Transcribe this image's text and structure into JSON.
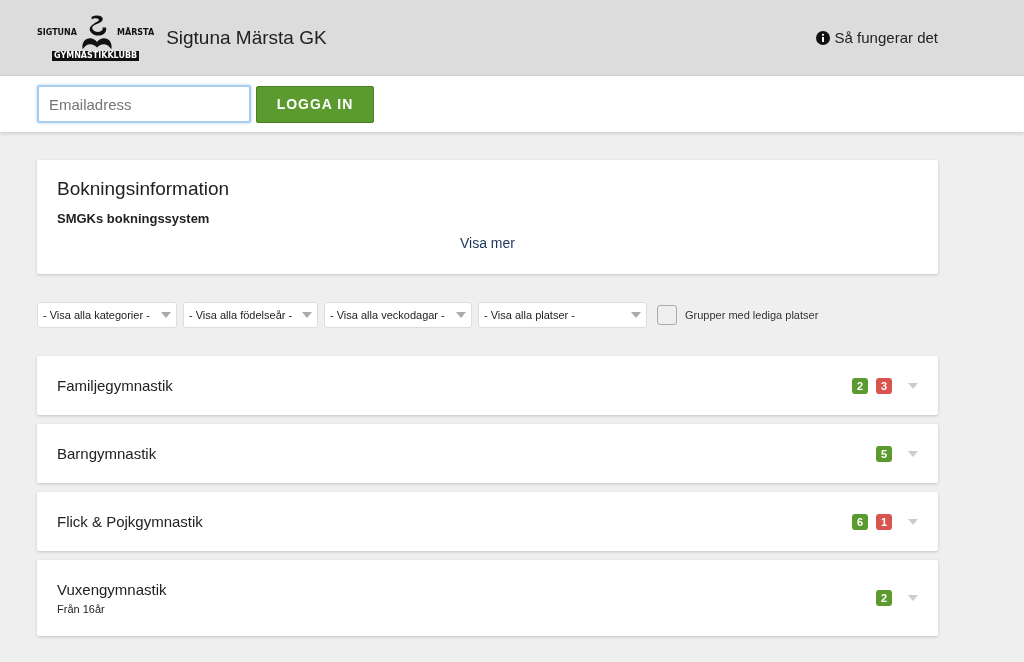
{
  "header": {
    "logo": {
      "top_left": "SIGTUNA",
      "top_right": "MÄRSTA",
      "bottom": "GYMNASTIKKLUBB"
    },
    "title": "Sigtuna Märsta GK",
    "help_link": "Så fungerar det"
  },
  "login": {
    "placeholder": "Emailadress",
    "button": "LOGGA IN"
  },
  "info_card": {
    "title": "Bokningsinformation",
    "subtitle": "SMGKs bokningssystem",
    "more_link": "Visa mer"
  },
  "filters": [
    {
      "value": "- Visa alla kategorier -"
    },
    {
      "value": "- Visa alla födelseår -"
    },
    {
      "value": "- Visa alla veckodagar -"
    },
    {
      "value": "- Visa alla platser -"
    }
  ],
  "free_spots_filter": {
    "label": "Grupper med lediga platser",
    "checked": false
  },
  "categories": [
    {
      "name": "Familjegymnastik",
      "expanded": false,
      "badges": [
        {
          "text": "2",
          "color": "#5b9a2e"
        },
        {
          "text": "3",
          "color": "#d9534f"
        }
      ]
    },
    {
      "name": "Barngymnastik",
      "expanded": false,
      "badges": [
        {
          "text": "5",
          "color": "#5b9a2e"
        }
      ]
    },
    {
      "name": "Flick & Pojkgymnastik",
      "expanded": false,
      "badges": [
        {
          "text": "6",
          "color": "#5b9a2e"
        },
        {
          "text": "1",
          "color": "#d9534f"
        }
      ]
    },
    {
      "name": "Vuxengymnastik",
      "subtitle": "Från 16år",
      "expanded": false,
      "badges": [
        {
          "text": "2",
          "color": "#5b9a2e"
        }
      ]
    }
  ]
}
